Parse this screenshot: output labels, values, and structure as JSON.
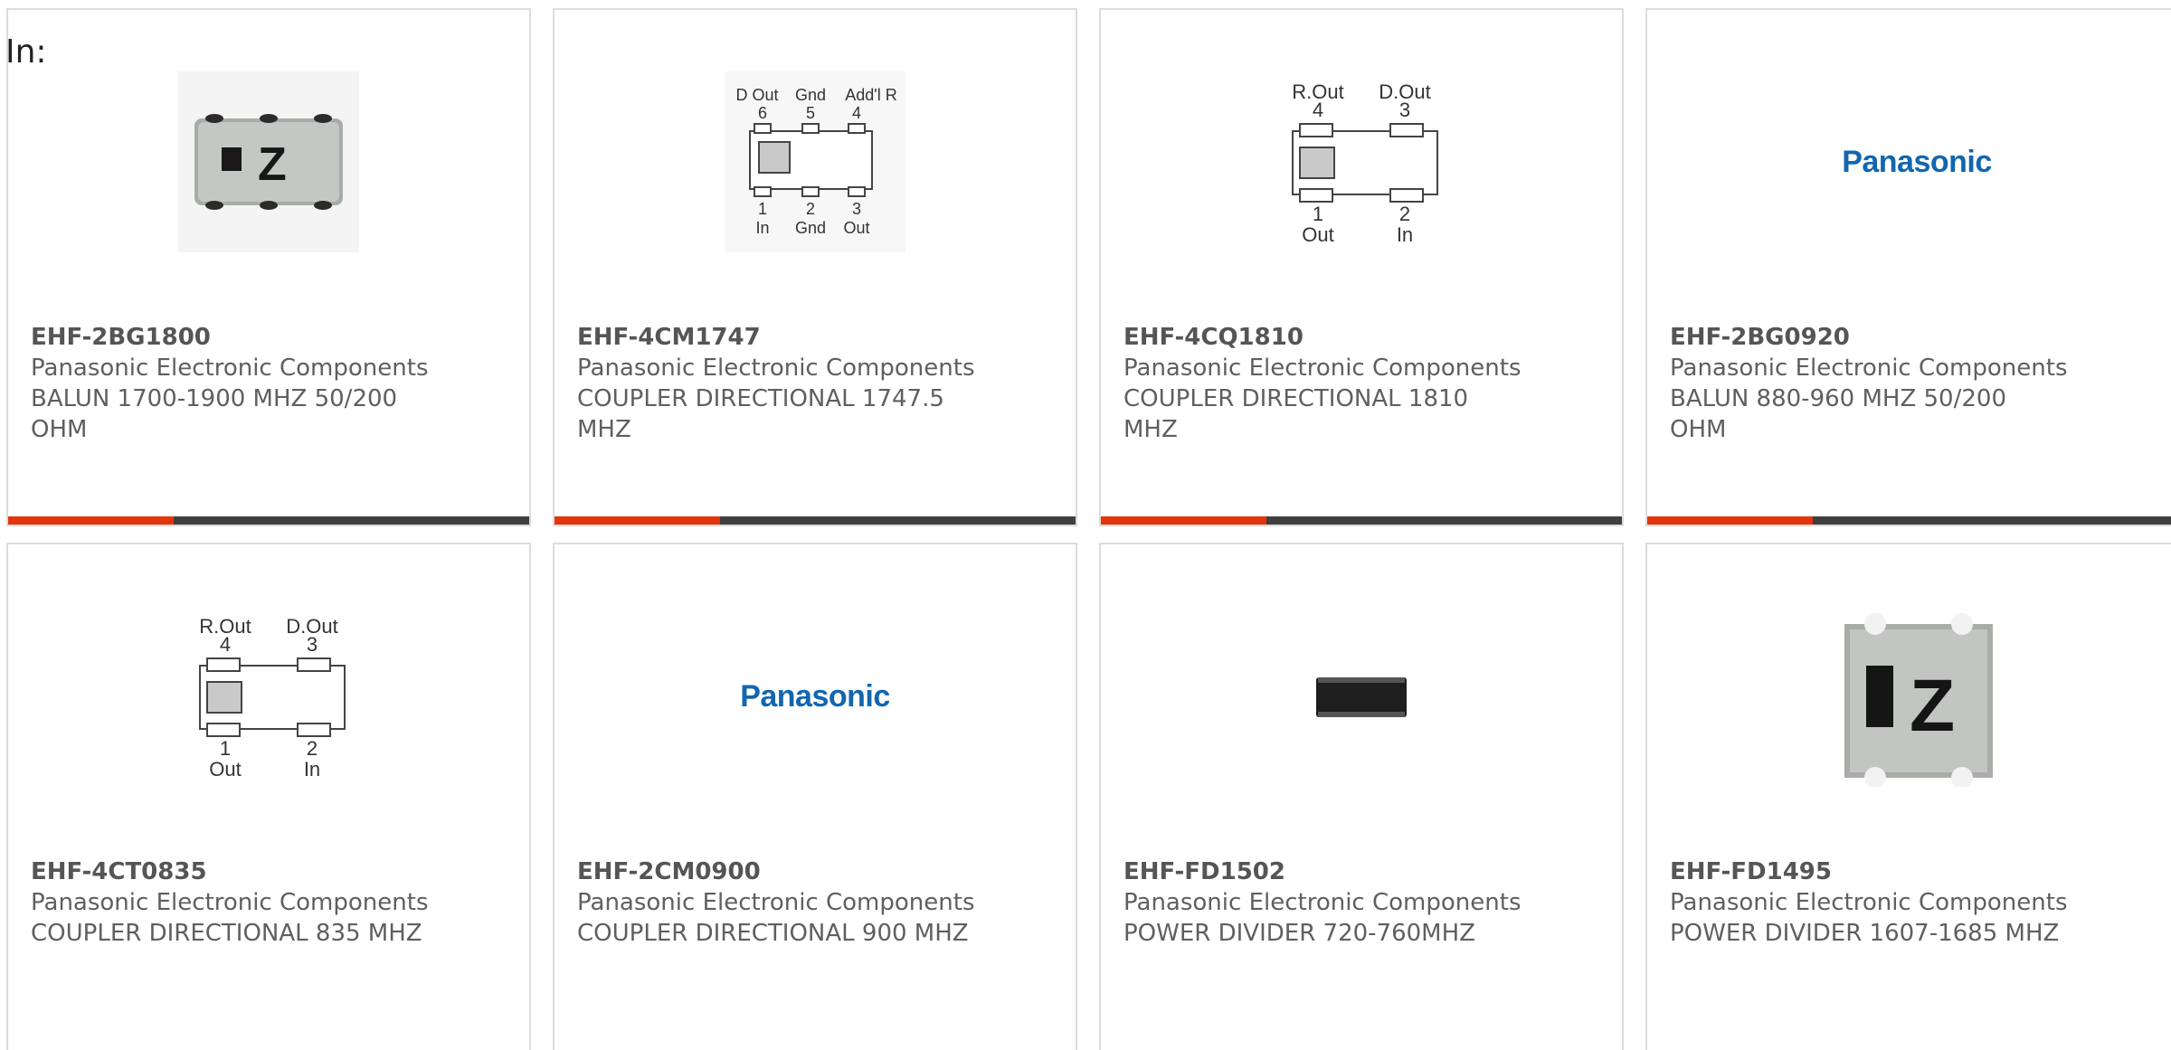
{
  "filter": {
    "label": "In:"
  },
  "brand": {
    "accent": "#e2350b",
    "bar": "#3f3f3f",
    "logo_color": "#1266b0"
  },
  "products": [
    {
      "part_number": "EHF-2BG1800",
      "manufacturer": "Panasonic Electronic Components",
      "description": "BALUN 1700-1900 MHZ 50/200 OHM",
      "image": "chip-photo-z",
      "chip_mark": "Z"
    },
    {
      "part_number": "EHF-4CM1747",
      "manufacturer": "Panasonic Electronic Components",
      "description": "COUPLER DIRECTIONAL 1747.5 MHZ",
      "image": "pinout-6-diagram",
      "pinout": {
        "top_labels": [
          "D Out",
          "Gnd",
          "Add'l R"
        ],
        "top_pins": [
          "6",
          "5",
          "4"
        ],
        "bottom_pins": [
          "1",
          "2",
          "3"
        ],
        "bottom_labels": [
          "In",
          "Gnd",
          "Out"
        ]
      }
    },
    {
      "part_number": "EHF-4CQ1810",
      "manufacturer": "Panasonic Electronic Components",
      "description": "COUPLER DIRECTIONAL 1810 MHZ",
      "image": "pinout-4-diagram",
      "pinout": {
        "top_labels": [
          "R.Out",
          "D.Out"
        ],
        "top_pins": [
          "4",
          "3"
        ],
        "bottom_pins": [
          "1",
          "2"
        ],
        "bottom_labels": [
          "Out",
          "In"
        ]
      }
    },
    {
      "part_number": "EHF-2BG0920",
      "manufacturer": "Panasonic Electronic Components",
      "description": "BALUN 880-960 MHZ 50/200 OHM",
      "image": "panasonic-logo",
      "logo": "Panasonic"
    },
    {
      "part_number": "EHF-4CT0835",
      "manufacturer": "Panasonic Electronic Components",
      "description": "COUPLER DIRECTIONAL 835 MHZ",
      "image": "pinout-4-diagram",
      "pinout": {
        "top_labels": [
          "R.Out",
          "D.Out"
        ],
        "top_pins": [
          "4",
          "3"
        ],
        "bottom_pins": [
          "1",
          "2"
        ],
        "bottom_labels": [
          "Out",
          "In"
        ]
      }
    },
    {
      "part_number": "EHF-2CM0900",
      "manufacturer": "Panasonic Electronic Components",
      "description": "COUPLER DIRECTIONAL 900 MHZ",
      "image": "panasonic-logo",
      "logo": "Panasonic"
    },
    {
      "part_number": "EHF-FD1502",
      "manufacturer": "Panasonic Electronic Components",
      "description": "POWER DIVIDER 720-760MHZ",
      "image": "chip-photo-small"
    },
    {
      "part_number": "EHF-FD1495",
      "manufacturer": "Panasonic Electronic Components",
      "description": "POWER DIVIDER 1607-1685 MHZ",
      "image": "chip-photo-z-large",
      "chip_mark": "Z"
    }
  ]
}
